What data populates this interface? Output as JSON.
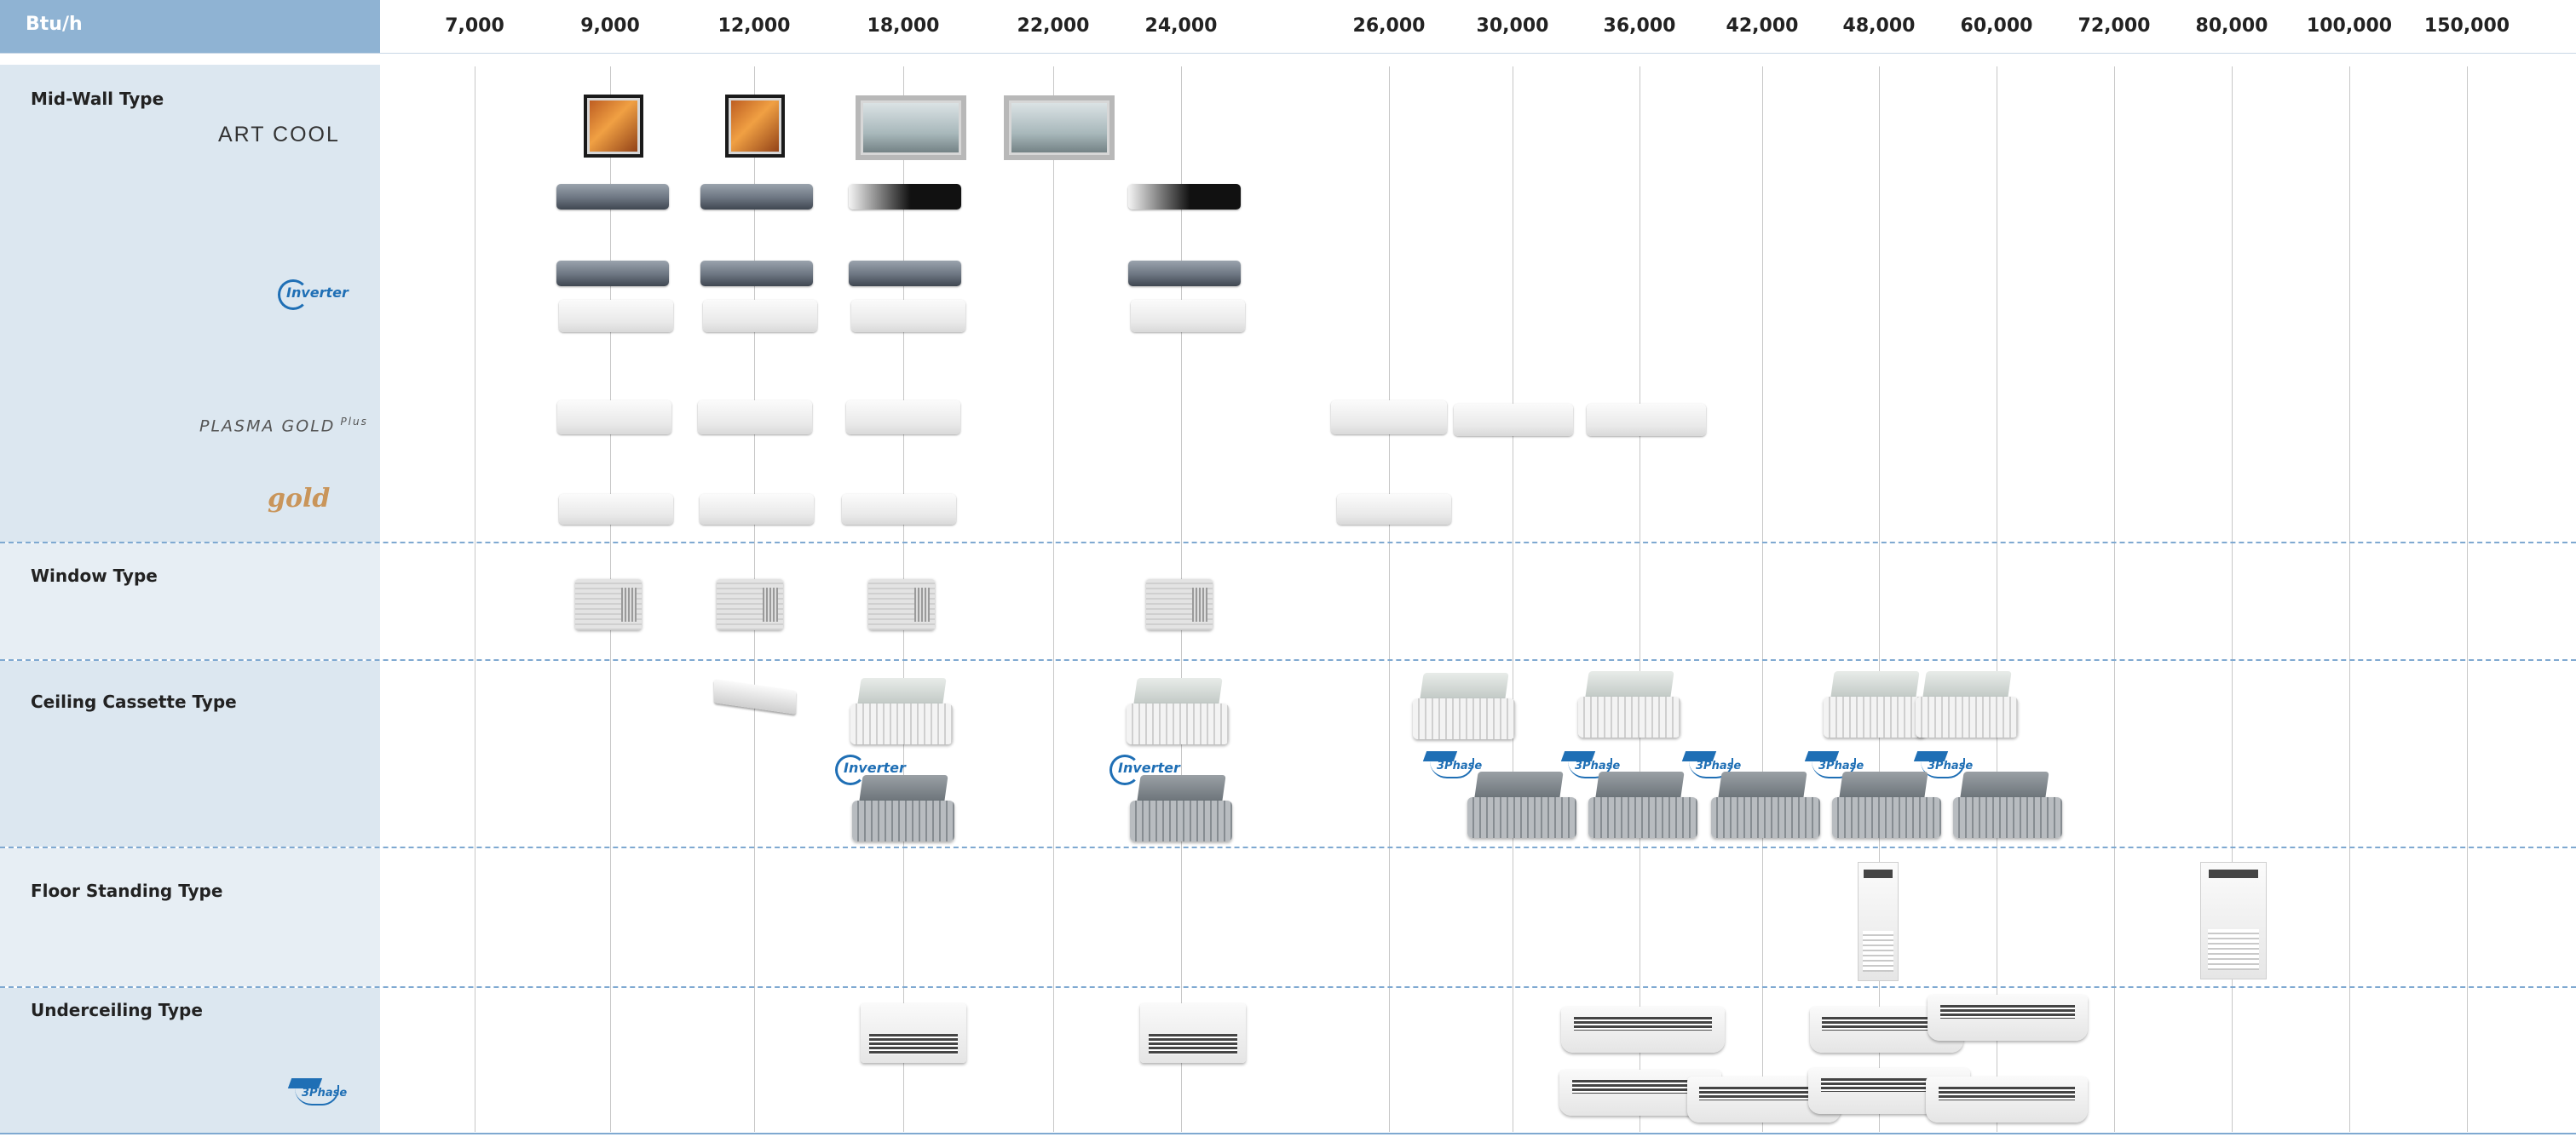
{
  "header": {
    "unit": "Btu/h",
    "capacities": [
      "7,000",
      "9,000",
      "12,000",
      "18,000",
      "22,000",
      "24,000",
      "26,000",
      "30,000",
      "36,000",
      "42,000",
      "48,000",
      "60,000",
      "72,000",
      "80,000",
      "100,000",
      "150,000"
    ]
  },
  "rows": {
    "midwall": {
      "title": "Mid-Wall Type",
      "brand_artcool": "ART COOL",
      "brand_inverter": "Inverter",
      "brand_plasma": "PLASMA GOLD",
      "brand_plasma_sup": "Plus",
      "brand_gold": "gold"
    },
    "window": {
      "title": "Window Type"
    },
    "cassette": {
      "title": "Ceiling Cassette Type",
      "badge_inverter": "Inverter",
      "badge_3phase": "3Phase"
    },
    "floor": {
      "title": "Floor Standing Type"
    },
    "under": {
      "title": "Underceiling Type",
      "badge_3phase": "3Phase"
    }
  },
  "colors": {
    "accent": "#8fb3d3",
    "left_panel": "#dce7f0",
    "separator": "#7fa9d1",
    "brand_blue": "#1f6fb5",
    "gold": "#c9955a"
  }
}
